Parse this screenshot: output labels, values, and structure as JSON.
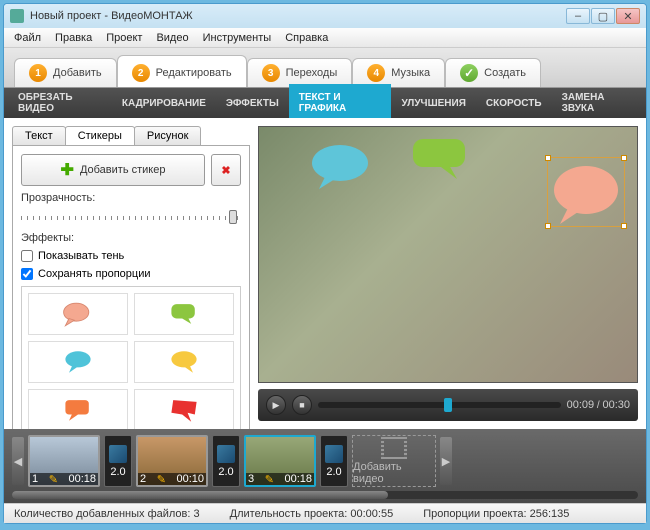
{
  "window": {
    "title": "Новый проект - ВидеоМОНТАЖ"
  },
  "menu": {
    "file": "Файл",
    "edit": "Правка",
    "project": "Проект",
    "video": "Видео",
    "tools": "Инструменты",
    "help": "Справка"
  },
  "steps": {
    "s1": {
      "n": "1",
      "label": "Добавить"
    },
    "s2": {
      "n": "2",
      "label": "Редактировать"
    },
    "s3": {
      "n": "3",
      "label": "Переходы"
    },
    "s4": {
      "n": "4",
      "label": "Музыка"
    },
    "s5": {
      "n": "✓",
      "label": "Создать"
    }
  },
  "subtabs": {
    "t1": "ОБРЕЗАТЬ ВИДЕО",
    "t2": "КАДРИРОВАНИЕ",
    "t3": "ЭФФЕКТЫ",
    "t4": "ТЕКСТ И ГРАФИКА",
    "t5": "УЛУЧШЕНИЯ",
    "t6": "СКОРОСТЬ",
    "t7": "ЗАМЕНА ЗВУКА"
  },
  "panel_tabs": {
    "text": "Текст",
    "stickers": "Стикеры",
    "picture": "Рисунок"
  },
  "stickers": {
    "add_btn": "Добавить стикер",
    "opacity_label": "Прозрачность:",
    "effects_label": "Эффекты:",
    "shadow": "Показывать тень",
    "keep_ratio": "Сохранять пропорции",
    "shadow_checked": false,
    "keep_ratio_checked": true
  },
  "player": {
    "current": "00:09",
    "total": "00:30"
  },
  "timeline": {
    "clips": [
      {
        "idx": "1",
        "dur": "00:18"
      },
      {
        "idx": "2",
        "dur": "00:10"
      },
      {
        "idx": "3",
        "dur": "00:18"
      }
    ],
    "transitions": [
      {
        "d": "2.0"
      },
      {
        "d": "2.0"
      },
      {
        "d": "2.0"
      }
    ],
    "add_video": "Добавить видео"
  },
  "status": {
    "files_label": "Количество добавленных файлов:",
    "files": "3",
    "duration_label": "Длительность проекта:",
    "duration": "00:00:55",
    "ratio_label": "Пропорции проекта:",
    "ratio": "256:135"
  },
  "colors": {
    "bubble_blue": "#5ec5d9",
    "bubble_green": "#8cc63f",
    "bubble_peach": "#f4a890",
    "bubble_cyan": "#4fc3d9",
    "bubble_yellow": "#f7c93f",
    "bubble_orange": "#f47b3f",
    "bubble_red": "#e8312f"
  }
}
